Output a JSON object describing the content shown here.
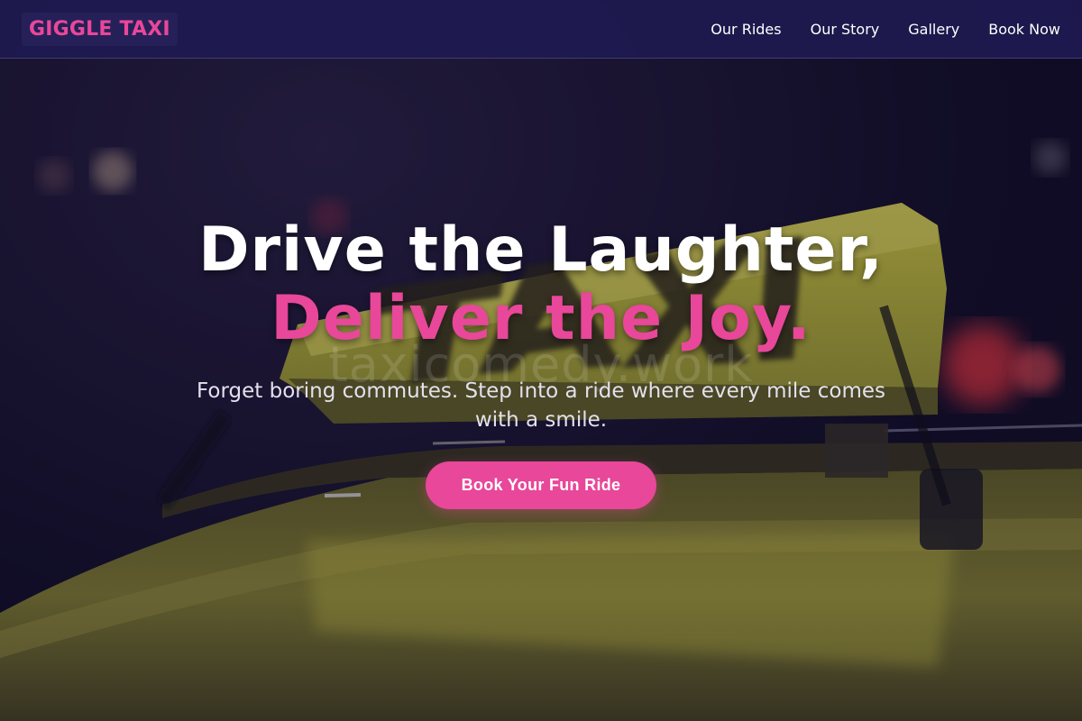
{
  "brand": {
    "name": "GIGGLE TAXI"
  },
  "nav": {
    "items": [
      {
        "label": "Our Rides"
      },
      {
        "label": "Our Story"
      },
      {
        "label": "Gallery"
      },
      {
        "label": "Book Now"
      }
    ]
  },
  "hero": {
    "headline_line1": "Drive the Laughter,",
    "headline_line2": "Deliver the Joy.",
    "watermark": "taxicomedy.work",
    "subtext": "Forget boring commutes. Step into a ride where every mile comes with a smile.",
    "cta_label": "Book Your Fun Ride",
    "background_image": "taxi-roof-sign-night",
    "background_sign_text": "TAXI"
  },
  "colors": {
    "accent": "#e8479a",
    "nav_bg": "#1e1a50",
    "overlay": "#161034",
    "sign_yellow": "#d8d83a"
  }
}
